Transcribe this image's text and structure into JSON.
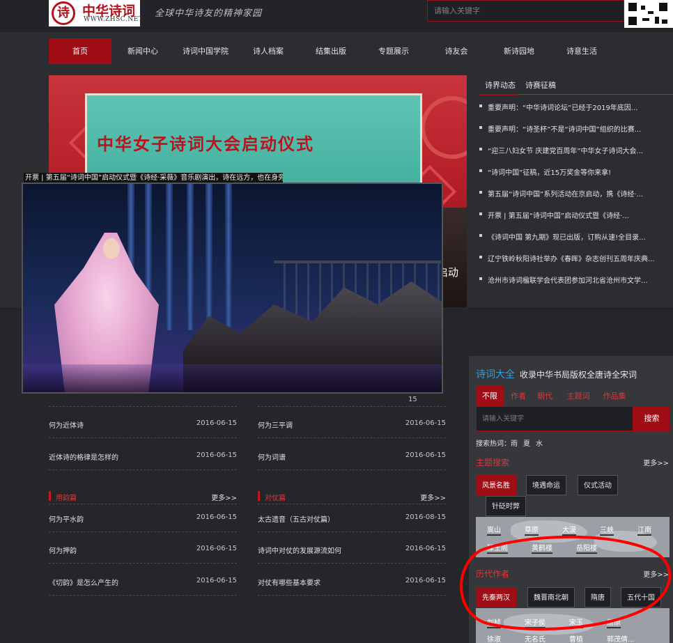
{
  "header": {
    "logo_cn": "中华诗词",
    "logo_en": "WWW.ZHSC.NET",
    "slogan": "全球中华诗友的精神家园",
    "search_placeholder": "请输入关键字"
  },
  "nav": [
    {
      "label": "首页",
      "active": true
    },
    {
      "label": "新闻中心"
    },
    {
      "label": "诗词中国学院"
    },
    {
      "label": "诗人档案"
    },
    {
      "label": "结集出版"
    },
    {
      "label": "专题展示"
    },
    {
      "label": "诗友会"
    },
    {
      "label": "新诗园地"
    },
    {
      "label": "诗意生活"
    }
  ],
  "banner": {
    "stage_title": "中华女子诗词大会启动仪式",
    "caption": "启动"
  },
  "popup": {
    "title": "开票 | 第五届“诗词中国”启动仪式暨《诗经·采薇》音乐剧演出，诗在远方，也在身旁!"
  },
  "news_tabs": [
    "诗界动态",
    "诗赛征稿"
  ],
  "news": [
    "重要声明：“中华诗词论坛”已经于2019年底因...",
    "重要声明：“诗圣杯”不是“诗词中国”组织的比赛...",
    "“迎三八妇女节 庆建党百周年”中华女子诗词大会...",
    "“诗词中国”征稿，近15万奖金等你来拿!",
    "第五届“诗词中国”系列活动在京启动，携《诗经·...",
    "开票 | 第五届“诗词中国”启动仪式暨《诗经·...",
    "《诗词中国 第九期》现已出版，订购从速!全目录...",
    "辽宁铁岭秋阳诗社举办《春晖》杂志创刊五周年庆典...",
    "沧州市诗词楹联学会代表团参加河北省沧州市文学..."
  ],
  "articles_top": {
    "left": [
      {
        "title": "何为近体诗",
        "date": "2016-06-15"
      },
      {
        "title": "近体诗的格律是怎样的",
        "date": "2016-06-15"
      }
    ],
    "right": [
      {
        "title": "何为三平调",
        "date": "2016-06-15"
      },
      {
        "title": "何为词谱",
        "date": "2016-06-15"
      }
    ],
    "partial_dates": [
      "2016-06-15"
    ]
  },
  "sections": {
    "yongyun": {
      "title": "用韵篇",
      "more": "更多>>",
      "items": [
        {
          "title": "何为平水韵",
          "date": "2016-06-15"
        },
        {
          "title": "何为押韵",
          "date": "2016-06-15"
        },
        {
          "title": "《切韵》是怎么产生的",
          "date": "2016-06-15"
        }
      ]
    },
    "duizhang": {
      "title": "对仗篇",
      "more": "更多>>",
      "items": [
        {
          "title": "太古遗音（五古对仗篇）",
          "date": "2016-08-15"
        },
        {
          "title": "诗词中对仗的发展源流如何",
          "date": "2016-06-15"
        },
        {
          "title": "对仗有哪些基本要求",
          "date": "2016-06-15"
        }
      ]
    }
  },
  "panel": {
    "title": "诗词大全",
    "subtitle": "收录中华书局版权全唐诗全宋词",
    "tabs": [
      "不限",
      "作者",
      "朝代",
      "主题词",
      "作品集"
    ],
    "search_placeholder": "请输入关键字",
    "search_button": "搜索",
    "hot_label": "搜索热词：",
    "hot_words": [
      "雨",
      "夏",
      "水"
    ],
    "theme": {
      "title": "主题搜索",
      "more": "更多>>",
      "pills": [
        "风景名胜",
        "境遇命运",
        "仪式活动",
        "针砭时弊"
      ],
      "places": [
        "嵩山",
        "草原",
        "大漠",
        "三峡",
        "江南",
        "滕王阁",
        "黄鹤楼",
        "岳阳楼"
      ]
    },
    "authors": {
      "title": "历代作者",
      "more": "更多>>",
      "pills": [
        "先秦两汉",
        "魏晋南北朝",
        "隋唐",
        "五代十国"
      ],
      "names": [
        "刘桢",
        "宋子侯",
        "宋玉",
        "屈原",
        "徐淑",
        "无名氏",
        "曹植",
        "郭茂倩..."
      ]
    }
  },
  "colors": {
    "accent": "#9e0d16",
    "link_blue": "#2ea0e6",
    "annotation": "#ff0000"
  }
}
